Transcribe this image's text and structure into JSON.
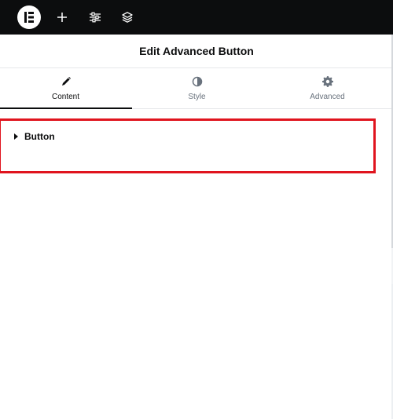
{
  "colors": {
    "topbar": "#0c0d0e",
    "accent_border": "#e0141e",
    "text_primary": "#0c0d0e",
    "text_secondary": "#69727d"
  },
  "topbar": {
    "logo_icon": "elementor-logo",
    "actions": [
      {
        "icon": "plus-icon"
      },
      {
        "icon": "sliders-icon"
      },
      {
        "icon": "layers-icon"
      }
    ]
  },
  "header": {
    "title": "Edit Advanced Button"
  },
  "tabs": [
    {
      "label": "Content",
      "icon": "pencil-icon",
      "active": true
    },
    {
      "label": "Style",
      "icon": "half-circle-icon",
      "active": false
    },
    {
      "label": "Advanced",
      "icon": "gear-icon",
      "active": false
    }
  ],
  "section": {
    "title": "Button",
    "expanded": false
  }
}
